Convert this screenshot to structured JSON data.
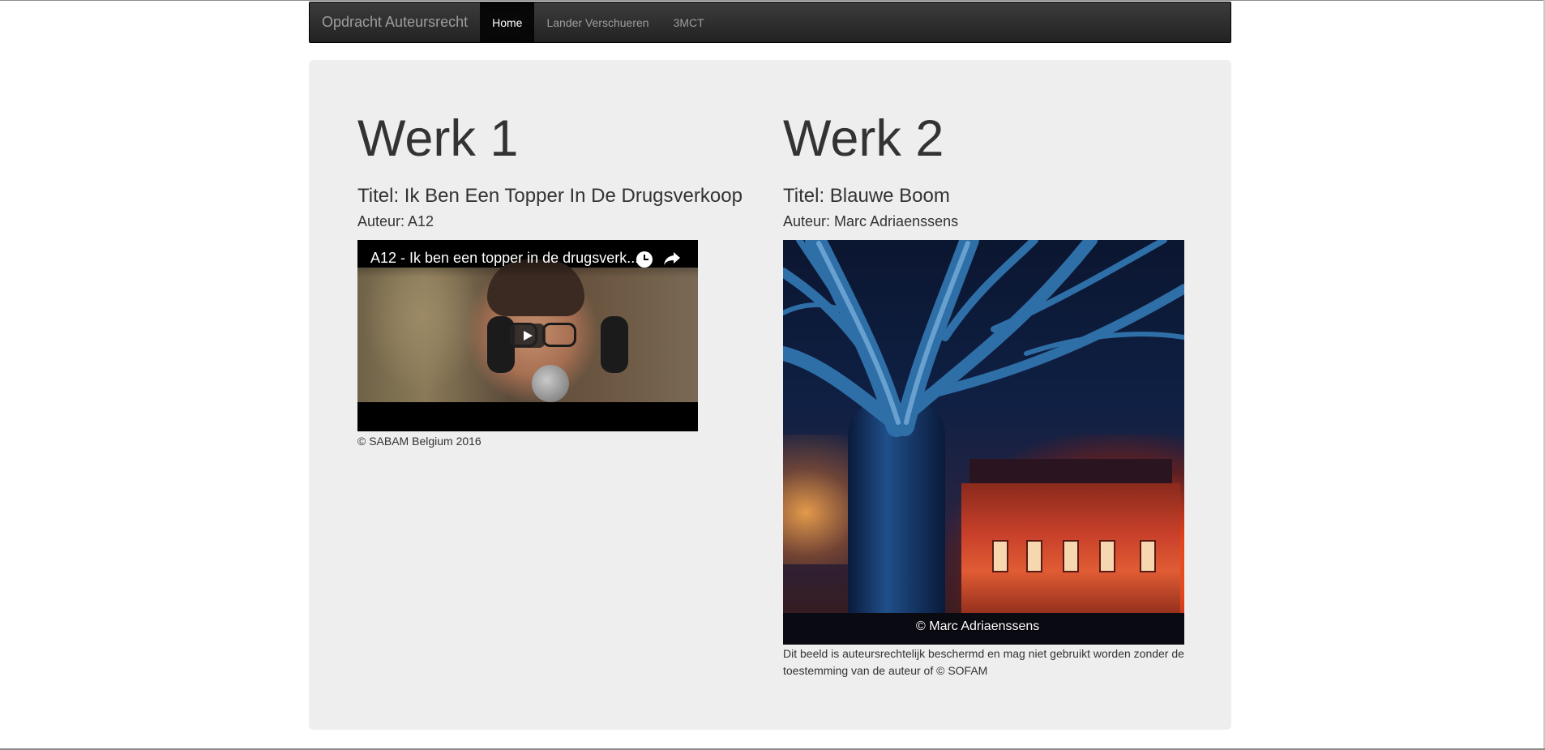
{
  "navbar": {
    "brand": "Opdracht Auteursrecht",
    "items": [
      {
        "label": "Home",
        "active": true
      },
      {
        "label": "Lander Verschueren",
        "active": false
      },
      {
        "label": "3MCT",
        "active": false
      }
    ]
  },
  "works": [
    {
      "heading": "Werk 1",
      "title": "Titel: Ik Ben Een Topper In De Drugsverkoop",
      "author": "Auteur: A12",
      "video_title": "A12 - Ik ben een topper in de drugsverk...",
      "caption": "© SABAM Belgium 2016"
    },
    {
      "heading": "Werk 2",
      "title": "Titel: Blauwe Boom",
      "author": "Auteur: Marc Adriaenssens",
      "photo_credit": "© Marc Adriaenssens",
      "caption": "Dit beeld is auteursrechtelijk beschermd en mag niet gebruikt worden zonder de toestemming van de auteur of © SOFAM"
    }
  ],
  "icons": {
    "watch_later": "clock-icon",
    "share": "share-icon",
    "play": "play-icon"
  },
  "colors": {
    "navbar_bg": "#222222",
    "navbar_active": "#080808",
    "navbar_text": "#9d9d9d",
    "jumbotron_bg": "#eeeeee",
    "text": "#333333"
  }
}
